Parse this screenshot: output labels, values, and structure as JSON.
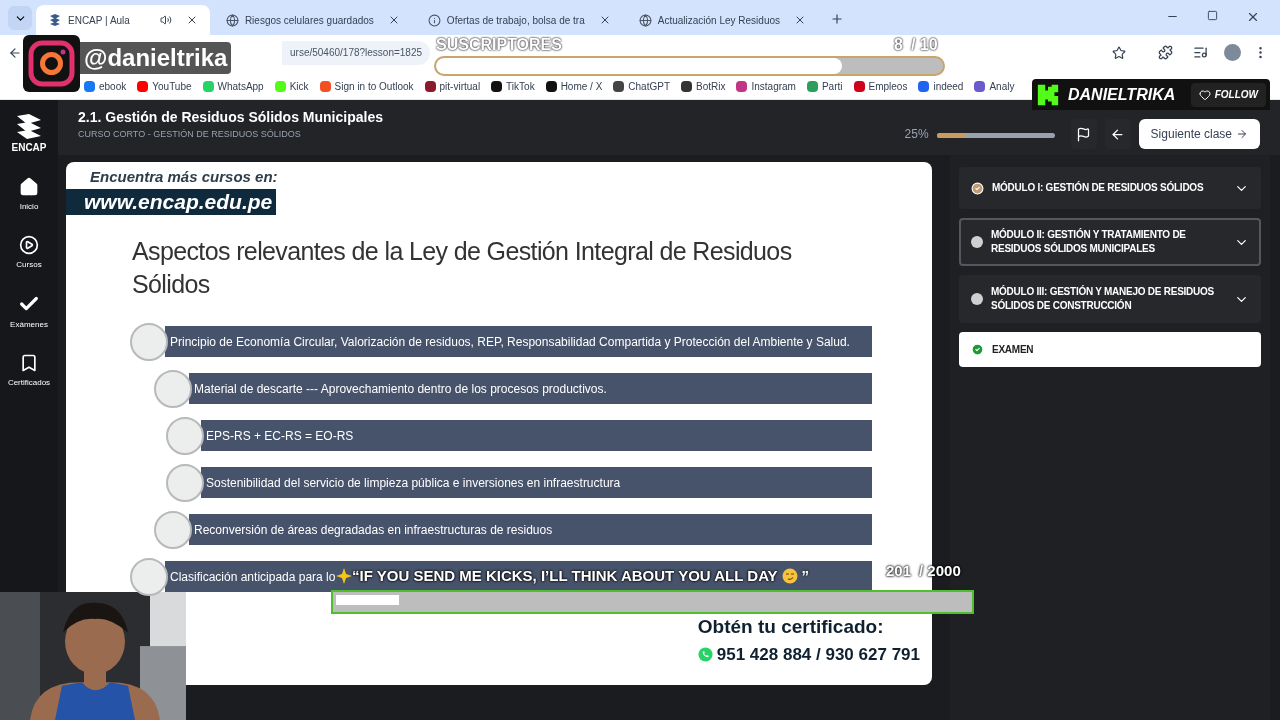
{
  "browser": {
    "tabs": [
      {
        "title": "ENCAP | Aula",
        "selected": true,
        "audio": true,
        "kind": "encap"
      },
      {
        "title": "Riesgos celulares guardados",
        "selected": false,
        "audio": false,
        "kind": "globe"
      },
      {
        "title": "Ofertas de trabajo, bolsa de tra",
        "selected": false,
        "audio": false,
        "kind": "info"
      },
      {
        "title": "Actualización Ley Residuos",
        "selected": false,
        "audio": false,
        "kind": "globe"
      }
    ],
    "address": "urse/50460/178?lesson=1825",
    "bookmarks": [
      {
        "label": "ebook",
        "color": "#1877f2"
      },
      {
        "label": "YouTube",
        "color": "#ff0000"
      },
      {
        "label": "WhatsApp",
        "color": "#25d366"
      },
      {
        "label": "Kick",
        "color": "#53fc18"
      },
      {
        "label": "Sign in to Outlook",
        "color": "#f25022"
      },
      {
        "label": "pit-virtual",
        "color": "#8b1a2b"
      },
      {
        "label": "TikTok",
        "color": "#111111"
      },
      {
        "label": "Home / X",
        "color": "#111111"
      },
      {
        "label": "ChatGPT",
        "color": "#444444"
      },
      {
        "label": "BotRix",
        "color": "#333333"
      },
      {
        "label": "Instagram",
        "color": "#c13584"
      },
      {
        "label": "Parti",
        "color": "#2e9e5b"
      },
      {
        "label": "Empleos",
        "color": "#d0021b"
      },
      {
        "label": "indeed",
        "color": "#2164f3"
      },
      {
        "label": "Analy",
        "color": "#6a5acd"
      }
    ]
  },
  "app": {
    "logo": "ENCAP",
    "nav": [
      {
        "label": "Inicio",
        "kind": "home"
      },
      {
        "label": "Cursos",
        "kind": "play"
      },
      {
        "label": "Exámenes",
        "kind": "check"
      },
      {
        "label": "Certificados",
        "kind": "bookmark"
      }
    ],
    "header": {
      "title": "2.1. Gestión de Residuos Sólidos Municipales",
      "subtitle": "CURSO CORTO - GESTIÓN DE RESIDUOS SÓLIDOS",
      "progress": {
        "reading": "25%",
        "level": 0.25
      },
      "next_button": "Siguiente clase"
    },
    "slide": {
      "promo_line": "Encuentra más cursos en:",
      "promo_url": "www.encap.edu.pe",
      "heading": "Aspectos relevantes de la Ley de Gestión Integral de Residuos Sólidos",
      "items": [
        "Principio de Economía Circular, Valorización de residuos, REP, Responsabilidad Compartida y Protección del Ambiente y Salud.",
        "Material de descarte --- Aprovechamiento dentro de los procesos productivos.",
        "EPS-RS + EC-RS = EO-RS",
        "Sostenibilidad del servicio de limpieza pública e inversiones en infraestructura",
        "Reconversión de áreas degradadas en infraestructuras de residuos",
        "Clasificación anticipada para lo"
      ],
      "certificate_title": "Obtén tu certificado:",
      "phones": "951 428 884 / 930 627 791"
    },
    "modules": [
      {
        "kind": "module",
        "title": "MÓDULO I: GESTIÓN DE RESIDUOS SÓLIDOS",
        "completed": true,
        "selected": false
      },
      {
        "kind": "module",
        "title": "MÓDULO II: GESTIÓN Y TRATAMIENTO DE RESIDUOS SÓLIDOS MUNICIPALES",
        "completed": false,
        "selected": true
      },
      {
        "kind": "module",
        "title": "MÓDULO III: GESTIÓN Y MANEJO DE RESIDUOS SÓLIDOS DE CONSTRUCCIÓN",
        "completed": false,
        "selected": false
      },
      {
        "kind": "exam",
        "title": "EXAMEN",
        "completed": true,
        "selected": false
      }
    ]
  },
  "overlays": {
    "instagram_handle": "@danieltrika",
    "subscriber_goal": {
      "title": "SUSCRIPTORES",
      "count": "8",
      "target": "/ 10",
      "level": 0.8
    },
    "kick": {
      "name": "DANIELTRIKA",
      "follow": "FOLLOW"
    },
    "kicks_goal": {
      "title": "“IF YOU SEND ME KICKS, I’LL THINK ABOUT YOU ALL DAY",
      "title_end": "”",
      "count": "201",
      "target": "/ 2000",
      "level": 0.1
    }
  }
}
